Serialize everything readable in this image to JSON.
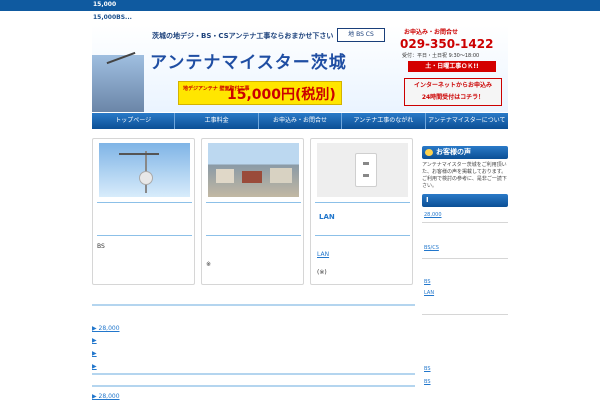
{
  "header": {
    "topbar": "15,000",
    "subline": "15,000BS...",
    "tagline": "茨城の地デジ・BS・CSアンテナ工事ならおまかせ下さい",
    "logos": "地 BS CS",
    "title": "アンテナマイスター茨城",
    "price_small": "地デジアンテナ 壁面取付工事",
    "price": "15,000円(税別)",
    "contact_label": "お申込み・お問合せ",
    "phone": "029-350-1422",
    "hours": "受付：平日・土日祝 9:30〜18:00",
    "weekend": "土・日曜工事ＯＫ!!",
    "net_line1": "インターネットからお申込み",
    "net_line2": "24時間受付はコチラ！"
  },
  "nav": [
    "トップページ",
    "工事料金",
    "お申込み・お問合せ",
    "アンテナ工事のながれ",
    "アンテナマイスターについて"
  ],
  "cards": [
    {
      "title": "",
      "text": "BS",
      "note": ""
    },
    {
      "title": "",
      "text": "",
      "note": "※"
    },
    {
      "title": "LAN",
      "link": "LAN",
      "note": "(※)"
    }
  ],
  "bullets": [
    {
      "text": "▶ 28,000",
      "suffix": ""
    },
    {
      "text": "▶",
      "suffix": ""
    },
    {
      "text": "▶",
      "suffix": ""
    },
    {
      "text": "▶",
      "suffix": ""
    },
    {
      "text": "▶ 28,000",
      "suffix": ""
    }
  ],
  "sidebar": {
    "voice_title": "お客様の声",
    "voice_text": "アンテナマイスター茨城をご利用頂いた、お客様の声を掲載しております。ご利用で検討の参考に、是非ご一読下さい。",
    "box_title": "I",
    "links": [
      "28,000",
      "BS/CS",
      "BS",
      "LAN",
      "BS",
      "BS"
    ]
  },
  "colors": {
    "primary": "#0f5aa0",
    "accent": "#d40000",
    "price_bg": "#ffe600"
  }
}
